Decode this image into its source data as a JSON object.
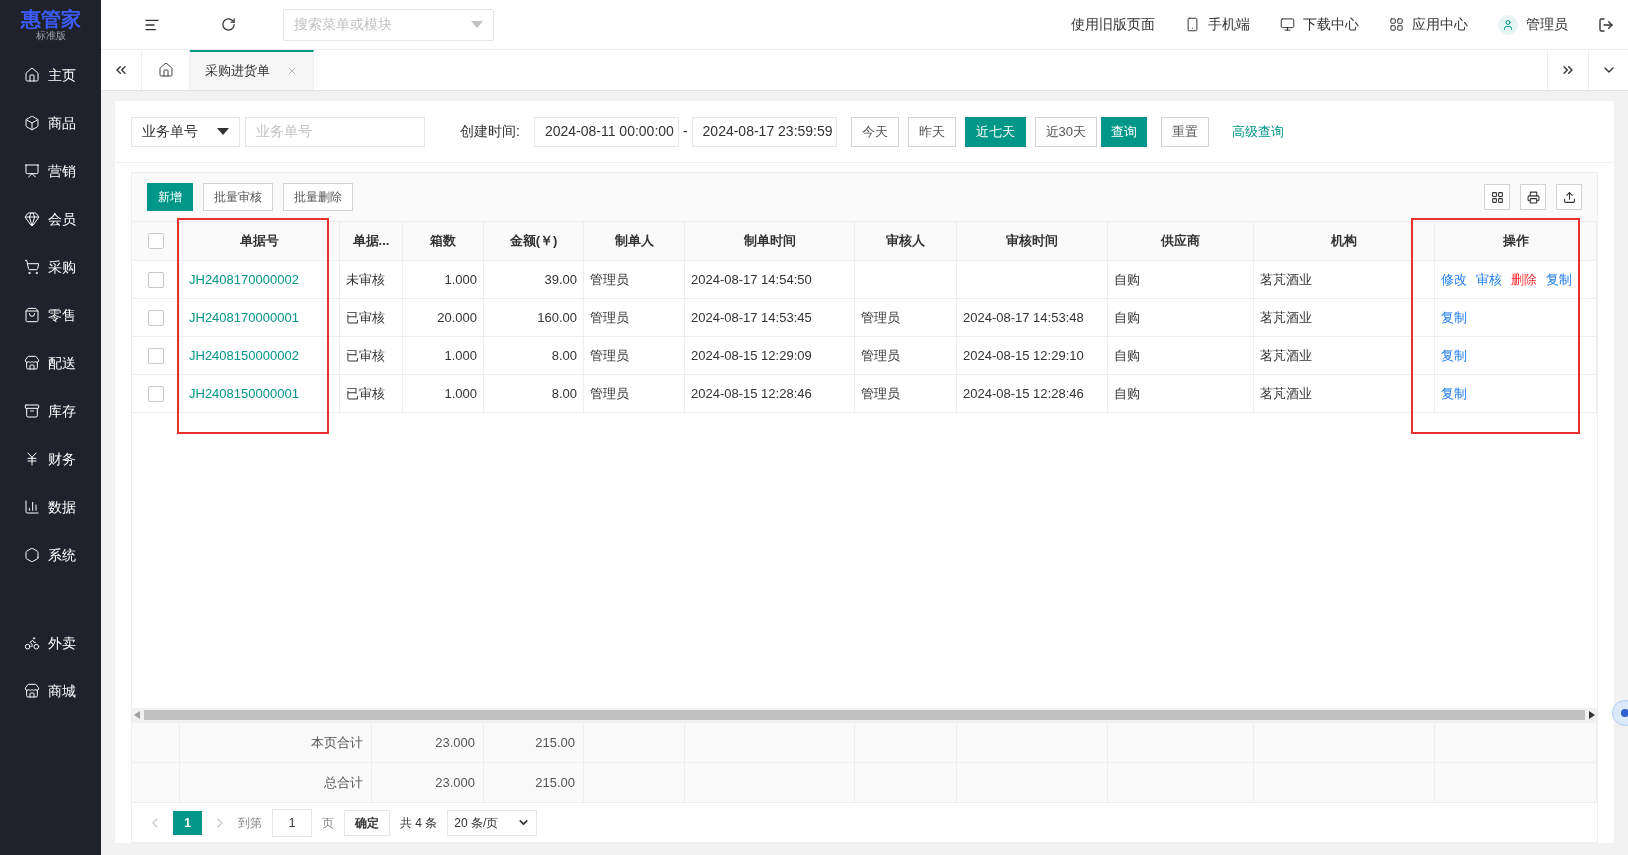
{
  "logo": {
    "name": "惠管家",
    "edition": "标准版"
  },
  "sidebar": {
    "items": [
      {
        "label": "主页"
      },
      {
        "label": "商品"
      },
      {
        "label": "营销"
      },
      {
        "label": "会员"
      },
      {
        "label": "采购"
      },
      {
        "label": "零售"
      },
      {
        "label": "配送"
      },
      {
        "label": "库存"
      },
      {
        "label": "财务"
      },
      {
        "label": "数据"
      },
      {
        "label": "系统"
      }
    ],
    "bottom_items": [
      {
        "label": "外卖"
      },
      {
        "label": "商城"
      }
    ]
  },
  "topbar": {
    "search_placeholder": "搜索菜单或模块",
    "links": [
      "使用旧版页面",
      "手机端",
      "下载中心",
      "应用中心",
      "管理员"
    ]
  },
  "tabs": [
    {
      "label": "采购进货单",
      "selected": true
    }
  ],
  "filter": {
    "field_select": "业务单号",
    "field_placeholder": "业务单号",
    "date_label": "创建时间:",
    "start": "2024-08-11 00:00:00",
    "separator": "-",
    "end": "2024-08-17 23:59:59",
    "quick_ranges": [
      {
        "label": "今天",
        "selected": false
      },
      {
        "label": "昨天",
        "selected": false
      },
      {
        "label": "近七天",
        "selected": true
      },
      {
        "label": "近30天",
        "selected": false
      }
    ],
    "query": "查询",
    "reset": "重置",
    "advanced": "高级查询"
  },
  "toolbar": {
    "buttons": [
      {
        "label": "新增",
        "primary": true
      },
      {
        "label": "批量审核",
        "primary": false
      },
      {
        "label": "批量删除",
        "primary": false
      }
    ]
  },
  "table": {
    "header_checked": false,
    "columns": [
      {
        "label": "单据号",
        "highlighted": true
      },
      {
        "label": "单据...",
        "highlighted": false
      },
      {
        "label": "箱数",
        "highlighted": false
      },
      {
        "label": "金额(￥)",
        "highlighted": false
      },
      {
        "label": "制单人",
        "highlighted": false
      },
      {
        "label": "制单时间",
        "highlighted": false
      },
      {
        "label": "审核人",
        "highlighted": false
      },
      {
        "label": "审核时间",
        "highlighted": false
      },
      {
        "label": "供应商",
        "highlighted": false
      },
      {
        "label": "机构",
        "highlighted": false
      },
      {
        "label": "操作",
        "highlighted": true
      }
    ],
    "rows": [
      {
        "checked": false,
        "number": "JH2408170000002",
        "status": "未审核",
        "boxes": "1.000",
        "amount": "39.00",
        "creator": "管理员",
        "created": "2024-08-17 14:54:50",
        "supplier": "自购",
        "org": "茗芃酒业",
        "actions": [
          {
            "label": "修改",
            "kind": "link"
          },
          {
            "label": "审核",
            "kind": "link"
          },
          {
            "label": "删除",
            "kind": "danger"
          },
          {
            "label": "复制",
            "kind": "link"
          }
        ]
      },
      {
        "checked": false,
        "number": "JH2408170000001",
        "status": "已审核",
        "boxes": "20.000",
        "amount": "160.00",
        "creator": "管理员",
        "created": "2024-08-17 14:53:45",
        "reviewer": "管理员",
        "reviewed": "2024-08-17 14:53:48",
        "supplier": "自购",
        "org": "茗芃酒业",
        "actions": [
          {
            "label": "复制",
            "kind": "link"
          }
        ]
      },
      {
        "checked": false,
        "number": "JH2408150000002",
        "status": "已审核",
        "boxes": "1.000",
        "amount": "8.00",
        "creator": "管理员",
        "created": "2024-08-15 12:29:09",
        "reviewer": "管理员",
        "reviewed": "2024-08-15 12:29:10",
        "supplier": "自购",
        "org": "茗芃酒业",
        "actions": [
          {
            "label": "复制",
            "kind": "link"
          }
        ]
      },
      {
        "checked": false,
        "number": "JH2408150000001",
        "status": "已审核",
        "boxes": "1.000",
        "amount": "8.00",
        "creator": "管理员",
        "created": "2024-08-15 12:28:46",
        "reviewer": "管理员",
        "reviewed": "2024-08-15 12:28:46",
        "supplier": "自购",
        "org": "茗芃酒业",
        "actions": [
          {
            "label": "复制",
            "kind": "link"
          }
        ]
      }
    ],
    "summary": [
      {
        "label": "本页合计",
        "boxes": "23.000",
        "amount": "215.00"
      },
      {
        "label": "总合计",
        "boxes": "23.000",
        "amount": "215.00"
      }
    ]
  },
  "pagination": {
    "pages": [
      {
        "label": "1",
        "selected": true
      }
    ],
    "goto_label": "到第",
    "goto_value": "1",
    "page_unit": "页",
    "confirm": "确定",
    "total": "共 4 条",
    "page_size": "20 条/页"
  }
}
